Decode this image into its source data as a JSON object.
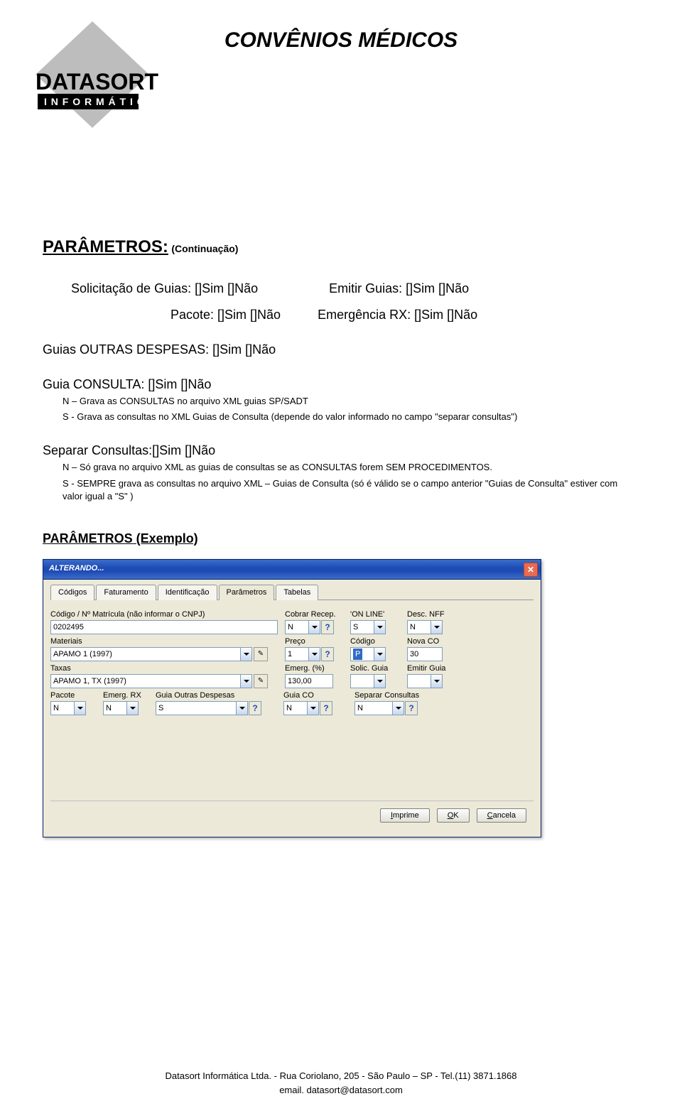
{
  "doc_title": "CONVÊNIOS MÉDICOS",
  "section_title": "PARÂMETROS:",
  "continuation": "(Continuação)",
  "rows": {
    "solicitacao": "Solicitação de Guias: []Sim   []Não",
    "emitir": "Emitir Guias: []Sim   []Não",
    "pacote": "Pacote: []Sim   []Não",
    "emergencia": "Emergência RX: []Sim   []Não",
    "outras": "Guias OUTRAS DESPESAS: []Sim   []Não"
  },
  "consulta": {
    "label": "Guia CONSULTA: []Sim   []Não",
    "n_desc": "N – Grava as CONSULTAS no arquivo  XML guias SP/SADT",
    "s_desc": "S  - Grava as consultas no XML Guias de Consulta (depende do valor informado no campo \"separar consultas\")"
  },
  "separar": {
    "label": "Separar Consultas:[]Sim   []Não",
    "n_desc": "N – Só grava no arquivo  XML as guias de consultas se as CONSULTAS forem SEM PROCEDIMENTOS.",
    "s_desc": "S  - SEMPRE grava as consultas no arquivo XML – Guias de Consulta (só é válido se o campo anterior \"Guias de Consulta\" estiver com valor igual a \"S\" )"
  },
  "example_title": "PARÂMETROS (Exemplo)",
  "dialog": {
    "title": "ALTERANDO...",
    "tabs": [
      "Códigos",
      "Faturamento",
      "Identificação",
      "Parâmetros",
      "Tabelas"
    ],
    "active_tab": "Parâmetros",
    "labels": {
      "codigo": "Código / Nº Matrícula (não informar o CNPJ)",
      "cobrar": "Cobrar Recep.",
      "online": "'ON LINE'",
      "desc_nff": "Desc. NFF",
      "materiais": "Materiais",
      "preco": "Preço",
      "codigo2": "Código",
      "nova_co": "Nova CO",
      "taxas": "Taxas",
      "emerg_pct": "Emerg. (%)",
      "solic_guia": "Solic. Guia",
      "emitir_guia": "Emitir Guia",
      "pacote": "Pacote",
      "emerg_rx": "Emerg. RX",
      "guia_outras": "Guia Outras Despesas",
      "guia_co": "Guia CO",
      "sep_consultas": "Separar Consultas"
    },
    "values": {
      "codigo": "0202495",
      "cobrar": "N",
      "online": "S",
      "desc_nff": "N",
      "materiais": "APAMO 1 (1997)",
      "preco": "1",
      "codigo2": "P",
      "nova_co": "30",
      "taxas": "APAMO 1, TX (1997)",
      "emerg_pct": "130,00",
      "solic_guia": "",
      "emitir_guia": "",
      "pacote": "N",
      "emerg_rx": "N",
      "guia_outras": "S",
      "guia_co": "N",
      "sep_consultas": "N"
    },
    "buttons": {
      "imprime": "Imprime",
      "ok": "OK",
      "cancela": "Cancela"
    }
  },
  "footer": {
    "line1": "Datasort Informática Ltda.     -      Rua Coriolano, 205     -     São Paulo – SP    -    Tel.(11) 3871.1868",
    "line2": "email. datasort@datasort.com"
  }
}
